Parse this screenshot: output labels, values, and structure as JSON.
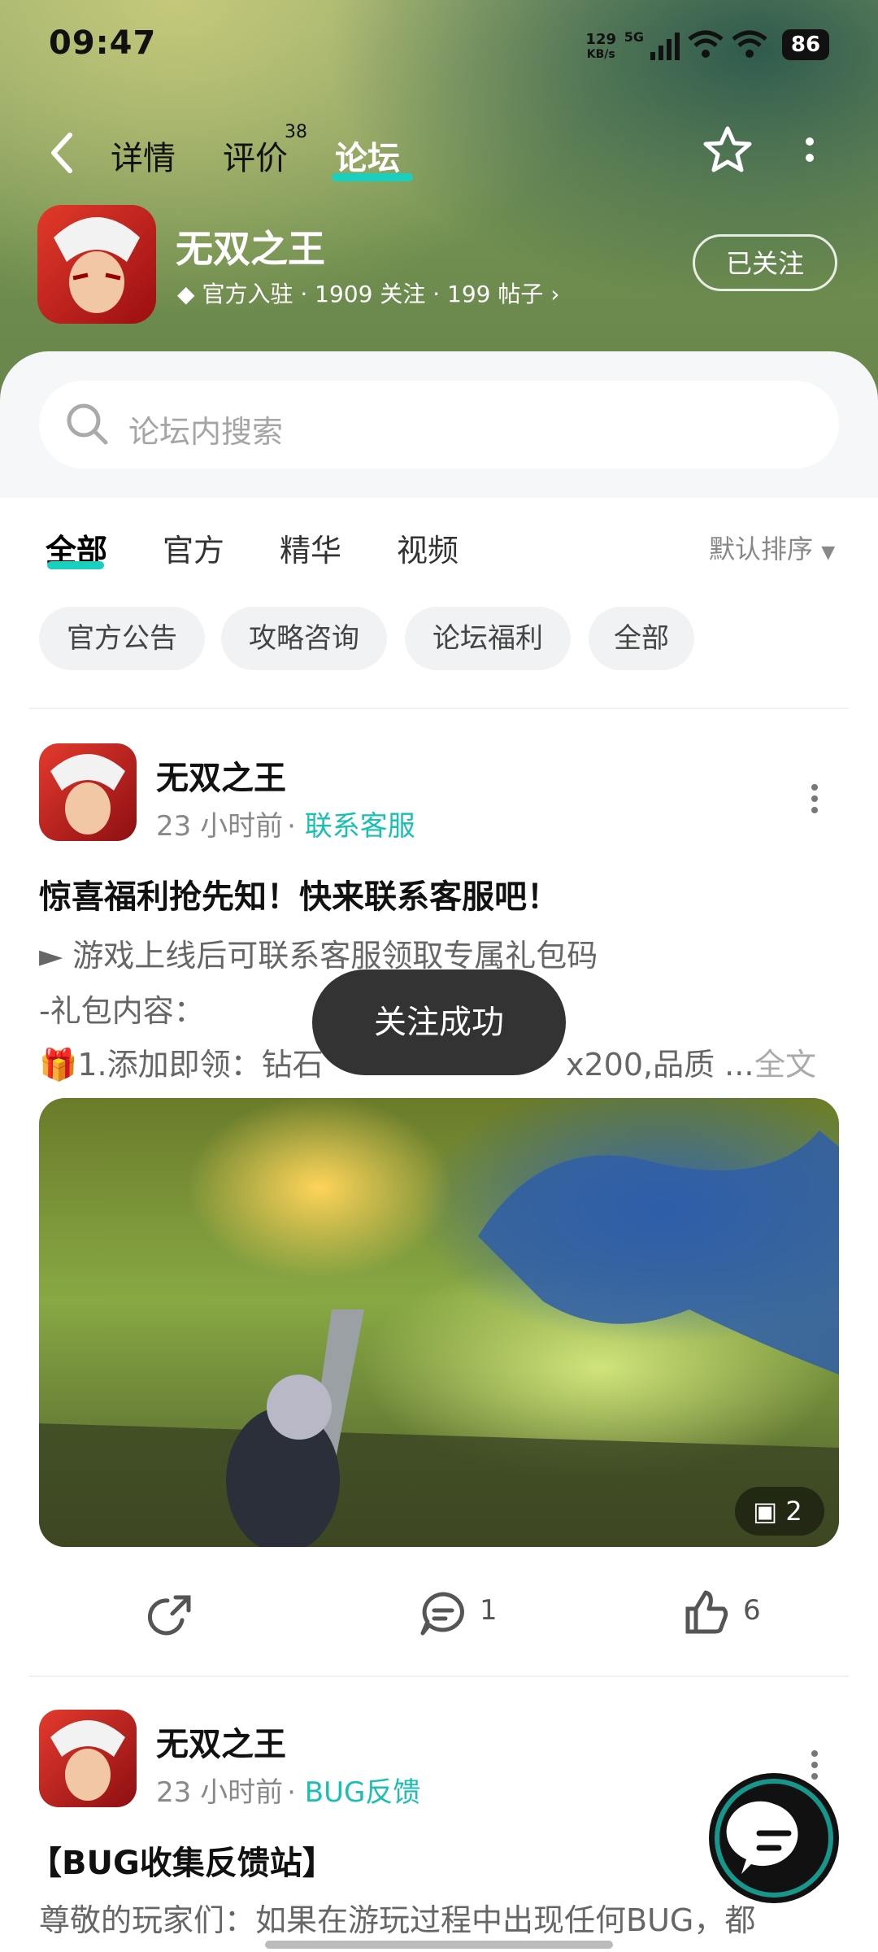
{
  "status_bar": {
    "time": "09:47",
    "speed": "129",
    "speed_unit": "KB/s",
    "network": "5G",
    "battery": "86"
  },
  "nav": {
    "tabs": [
      {
        "label": "详情"
      },
      {
        "label": "评价",
        "badge": "38"
      },
      {
        "label": "论坛",
        "active": true
      }
    ]
  },
  "game": {
    "name": "无双之王",
    "meta": "官方入驻 · 1909 关注 · 199 帖子",
    "follow_label": "已关注"
  },
  "search": {
    "placeholder": "论坛内搜索"
  },
  "filters": {
    "tabs": [
      "全部",
      "官方",
      "精华",
      "视频"
    ],
    "sort_label": "默认排序",
    "chips": [
      "官方公告",
      "攻略咨询",
      "论坛福利",
      "全部"
    ]
  },
  "posts": [
    {
      "author": "无双之王",
      "time": "23 小时前",
      "tag": "联系客服",
      "title": "惊喜福利抢先知！快来联系客服吧！",
      "lines": [
        "► 游戏上线后可联系客服领取专属礼包码",
        "-礼包内容：",
        "🎁1.添加即领：钻石",
        "x200,品质 ..."
      ],
      "fulltext_label": "全文",
      "image_count": "2",
      "comments": "1",
      "likes": "6"
    },
    {
      "author": "无双之王",
      "time": "23 小时前",
      "tag": "BUG反馈",
      "title": "【BUG收集反馈站】",
      "lines": [
        "尊敬的玩家们：如果在游玩过程中出现任何BUG，都"
      ]
    }
  ],
  "toast": "关注成功",
  "colors": {
    "accent": "#19cfc0",
    "tag": "#19bfb2"
  }
}
